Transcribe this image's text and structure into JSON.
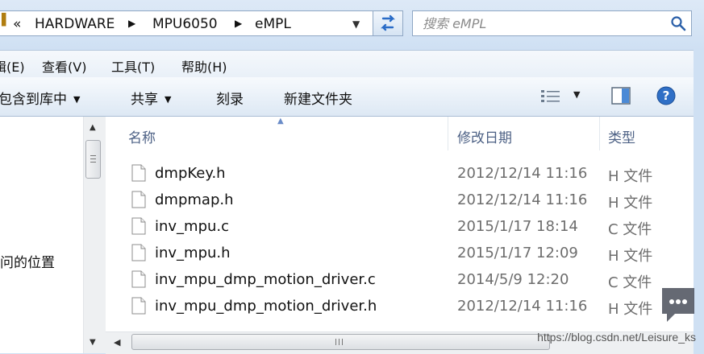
{
  "address_bar": {
    "chevron": "«",
    "crumbs": [
      "HARDWARE",
      "MPU6050",
      "eMPL"
    ],
    "separator": "▶"
  },
  "search": {
    "placeholder": "搜索 eMPL"
  },
  "menu": [
    "辑(E)",
    "查看(V)",
    "工具(T)",
    "帮助(H)"
  ],
  "toolbar": {
    "include_in_library": "包含到库中",
    "share": "共享",
    "burn": "刻录",
    "new_folder": "新建文件夹"
  },
  "nav": {
    "partial_label": "问的位置"
  },
  "columns": {
    "name": "名称",
    "date": "修改日期",
    "type": "类型"
  },
  "files": [
    {
      "name": "dmpKey.h",
      "date": "2012/12/14 11:16",
      "type": "H 文件"
    },
    {
      "name": "dmpmap.h",
      "date": "2012/12/14 11:16",
      "type": "H 文件"
    },
    {
      "name": "inv_mpu.c",
      "date": "2015/1/17 18:14",
      "type": "C 文件"
    },
    {
      "name": "inv_mpu.h",
      "date": "2015/1/17 12:09",
      "type": "H 文件"
    },
    {
      "name": "inv_mpu_dmp_motion_driver.c",
      "date": "2014/5/9 12:20",
      "type": "C 文件"
    },
    {
      "name": "inv_mpu_dmp_motion_driver.h",
      "date": "2012/12/14 11:16",
      "type": "H 文件"
    }
  ],
  "watermark": "https://blog.csdn.net/Leisure_ks",
  "colors": {
    "header_text": "#4d6185",
    "accent_blue": "#2a6cc7",
    "frame": "#cfe0f3"
  }
}
